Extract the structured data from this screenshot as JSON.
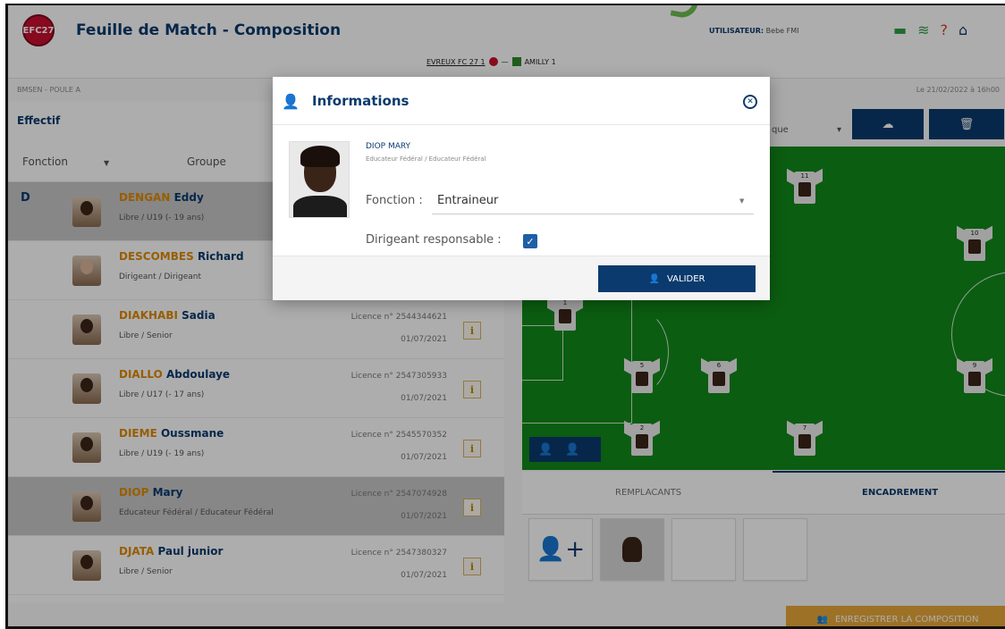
{
  "header": {
    "logo_text": "EFC27",
    "title": "Feuille de Match - Composition",
    "user_label": "UTILISATEUR:",
    "user_name": "Bebe FMI",
    "match_home": "EVREUX FC 27 1",
    "match_sep": "—",
    "match_away": "AMILLY 1",
    "poule": "BMSEN - POULE A",
    "date": "Le 21/02/2022 à 16h00"
  },
  "left": {
    "section_title": "Effectif",
    "filter_fonction": "Fonction",
    "filter_groupe": "Groupe",
    "players": [
      {
        "letter": "D",
        "last": "DENGAN",
        "first": "Eddy",
        "cat": "Libre / U19 (- 19 ans)",
        "lic": "",
        "date": "",
        "selected": true,
        "light": false
      },
      {
        "letter": "",
        "last": "DESCOMBES",
        "first": "Richard",
        "cat": "Dirigeant / Dirigeant",
        "lic": "",
        "date": "",
        "selected": false,
        "light": true
      },
      {
        "letter": "",
        "last": "DIAKHABI",
        "first": "Sadia",
        "cat": "Libre / Senior",
        "lic": "Licence n° 2544344621",
        "date": "01/07/2021",
        "selected": false,
        "light": false
      },
      {
        "letter": "",
        "last": "DIALLO",
        "first": "Abdoulaye",
        "cat": "Libre / U17 (- 17 ans)",
        "lic": "Licence n° 2547305933",
        "date": "01/07/2021",
        "selected": false,
        "light": false
      },
      {
        "letter": "",
        "last": "DIEME",
        "first": "Oussmane",
        "cat": "Libre / U19 (- 19 ans)",
        "lic": "Licence n° 2545570352",
        "date": "01/07/2021",
        "selected": false,
        "light": false
      },
      {
        "letter": "",
        "last": "DIOP",
        "first": "Mary",
        "cat": "Educateur Fédéral / Educateur Fédéral",
        "lic": "Licence n° 2547074928",
        "date": "01/07/2021",
        "selected": true,
        "light": false
      },
      {
        "letter": "",
        "last": "DJATA",
        "first": "Paul junior",
        "cat": "Libre / Senior",
        "lic": "Licence n° 2547380327",
        "date": "01/07/2021",
        "selected": false,
        "light": false
      }
    ],
    "info_label": "i"
  },
  "right": {
    "select_value": "que",
    "tabs": {
      "remplacants": "REMPLACANTS",
      "encadrement": "ENCADREMENT"
    },
    "shirts": [
      "11",
      "10",
      "1",
      "5",
      "6",
      "9",
      "2",
      "7"
    ],
    "save_label": "ENREGISTRER LA COMPOSITION"
  },
  "modal": {
    "title": "Informations",
    "close_label": "⊗",
    "person_name": "DIOP MARY",
    "person_role": "Educateur Fédéral / Educateur Fédéral",
    "fonction_label": "Fonction :",
    "fonction_value": "Entraineur",
    "dirigeant_label": "Dirigeant responsable :",
    "dirigeant_checked": true,
    "valider_label": "VALIDER"
  },
  "colors": {
    "primary": "#0b3a6e",
    "accent": "#e08a00",
    "pitch": "#118a1a",
    "save": "#e8a93a"
  }
}
